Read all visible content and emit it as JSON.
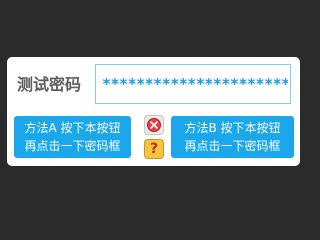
{
  "form": {
    "password_label": "测试密码",
    "password_value": "*************************"
  },
  "buttons": {
    "method_a_line1": "方法A 按下本按钮",
    "method_a_line2": "再点击一下密码框",
    "method_b_line1": "方法B 按下本按钮",
    "method_b_line2": "再点击一下密码框"
  },
  "icons": {
    "clear": "close-icon",
    "help": "help-icon",
    "help_glyph": "?"
  },
  "colors": {
    "accent": "#1aa7ec",
    "password_text": "#1a9edb",
    "field_border": "#7fd0ee",
    "background": "#2b2b2b",
    "close_red": "#e8404a",
    "help_yellow": "#f5c53d"
  }
}
